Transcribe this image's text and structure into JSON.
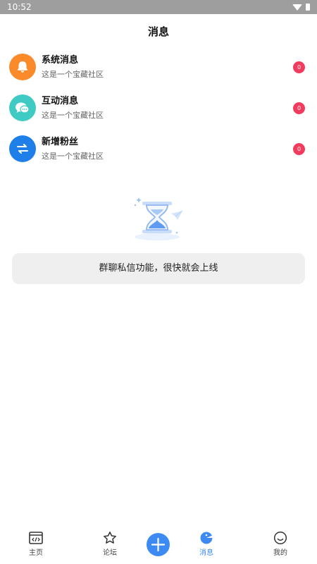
{
  "status_bar": {
    "time": "10:52"
  },
  "header": {
    "title": "消息"
  },
  "messages": [
    {
      "title": "系统消息",
      "subtitle": "这是一个宝藏社区",
      "badge": "0",
      "icon": "bell-icon",
      "color": "#fb8b2a"
    },
    {
      "title": "互动消息",
      "subtitle": "这是一个宝藏社区",
      "badge": "0",
      "icon": "chat-bubble-icon",
      "color": "#3fcbc4"
    },
    {
      "title": "新增粉丝",
      "subtitle": "这是一个宝藏社区",
      "badge": "0",
      "icon": "swap-arrows-icon",
      "color": "#1f7fe8"
    }
  ],
  "empty_state": {
    "notice": "群聊私信功能，很快就会上线",
    "illustration": "hourglass-icon"
  },
  "tabbar": {
    "items": [
      {
        "label": "主页",
        "icon": "code-window-icon",
        "active": false
      },
      {
        "label": "论坛",
        "icon": "star-icon",
        "active": false
      },
      {
        "label": "",
        "icon": "plus-icon",
        "active": false
      },
      {
        "label": "消息",
        "icon": "message-icon",
        "active": true
      },
      {
        "label": "我的",
        "icon": "smiley-icon",
        "active": false
      }
    ]
  },
  "colors": {
    "accent": "#3d8bf2",
    "badge": "#f23c5e",
    "status_bar": "#9e9e9e",
    "notice_bg": "#efefef"
  }
}
